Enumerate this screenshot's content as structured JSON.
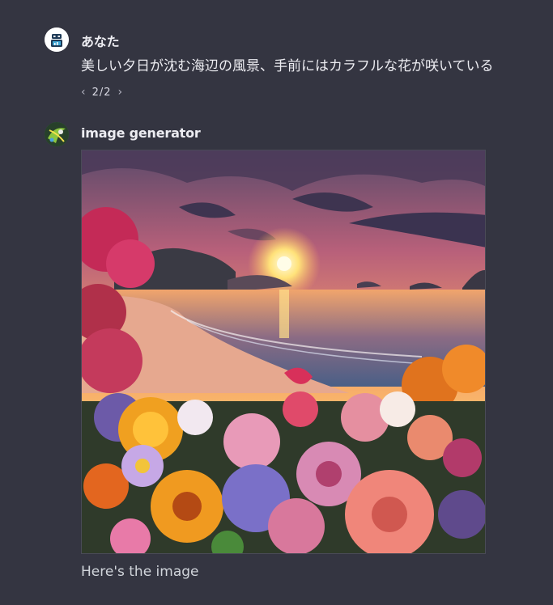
{
  "messages": {
    "user": {
      "author": "あなた",
      "text": "美しい夕日が沈む海辺の風景、手前にはカラフルな花が咲いている",
      "pager": {
        "current_total": "2/2"
      },
      "avatar_icon": "robot-avatar-icon"
    },
    "assistant": {
      "author": "image generator",
      "image_icon": "generated-sunset-seaside-flowers-image",
      "caption": "Here's the image",
      "avatar_icon": "green-leaf-avatar-icon"
    }
  },
  "colors": {
    "background": "#343541",
    "text": "#ececf1",
    "muted": "#b4b4c2"
  }
}
